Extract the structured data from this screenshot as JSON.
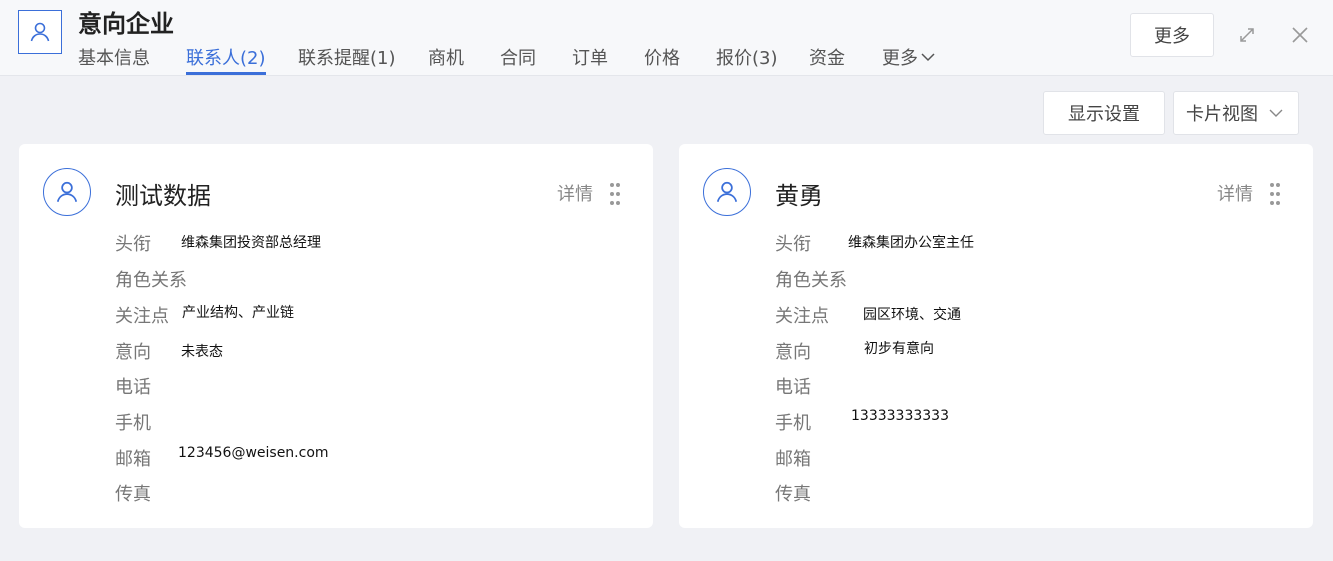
{
  "header": {
    "title": "意向企业",
    "tabs": [
      {
        "label": "基本信息"
      },
      {
        "label": "联系人(2)"
      },
      {
        "label": "联系提醒(1)"
      },
      {
        "label": "商机"
      },
      {
        "label": "合同"
      },
      {
        "label": "订单"
      },
      {
        "label": "价格"
      },
      {
        "label": "报价(3)"
      },
      {
        "label": "资金"
      },
      {
        "label": "更多"
      }
    ],
    "active_tab": "联系人(2)",
    "more_button": "更多"
  },
  "toolbar": {
    "display_settings": "显示设置",
    "view_mode": "卡片视图"
  },
  "cards": [
    {
      "name": "测试数据",
      "detail_label": "详情",
      "fields": [
        {
          "label": "头衔",
          "value": "维森集团投资部总经理"
        },
        {
          "label": "角色关系",
          "value": ""
        },
        {
          "label": "关注点",
          "value": "产业结构、产业链"
        },
        {
          "label": "意向",
          "value": "未表态"
        },
        {
          "label": "电话",
          "value": ""
        },
        {
          "label": "手机",
          "value": ""
        },
        {
          "label": "邮箱",
          "value": "123456@weisen.com"
        },
        {
          "label": "传真",
          "value": ""
        }
      ]
    },
    {
      "name": "黄勇",
      "detail_label": "详情",
      "fields": [
        {
          "label": "头衔",
          "value": "维森集团办公室主任"
        },
        {
          "label": "角色关系",
          "value": ""
        },
        {
          "label": "关注点",
          "value": "园区环境、交通"
        },
        {
          "label": "意向",
          "value": "初步有意向"
        },
        {
          "label": "电话",
          "value": ""
        },
        {
          "label": "手机",
          "value": "13333333333"
        },
        {
          "label": "邮箱",
          "value": ""
        },
        {
          "label": "传真",
          "value": ""
        }
      ]
    }
  ],
  "colors": {
    "accent": "#3b6fd9",
    "background": "#f0f1f5"
  },
  "icons": [
    "user-icon",
    "expand-icon",
    "close-icon",
    "chevron-down-icon",
    "drag-handle-icon"
  ]
}
